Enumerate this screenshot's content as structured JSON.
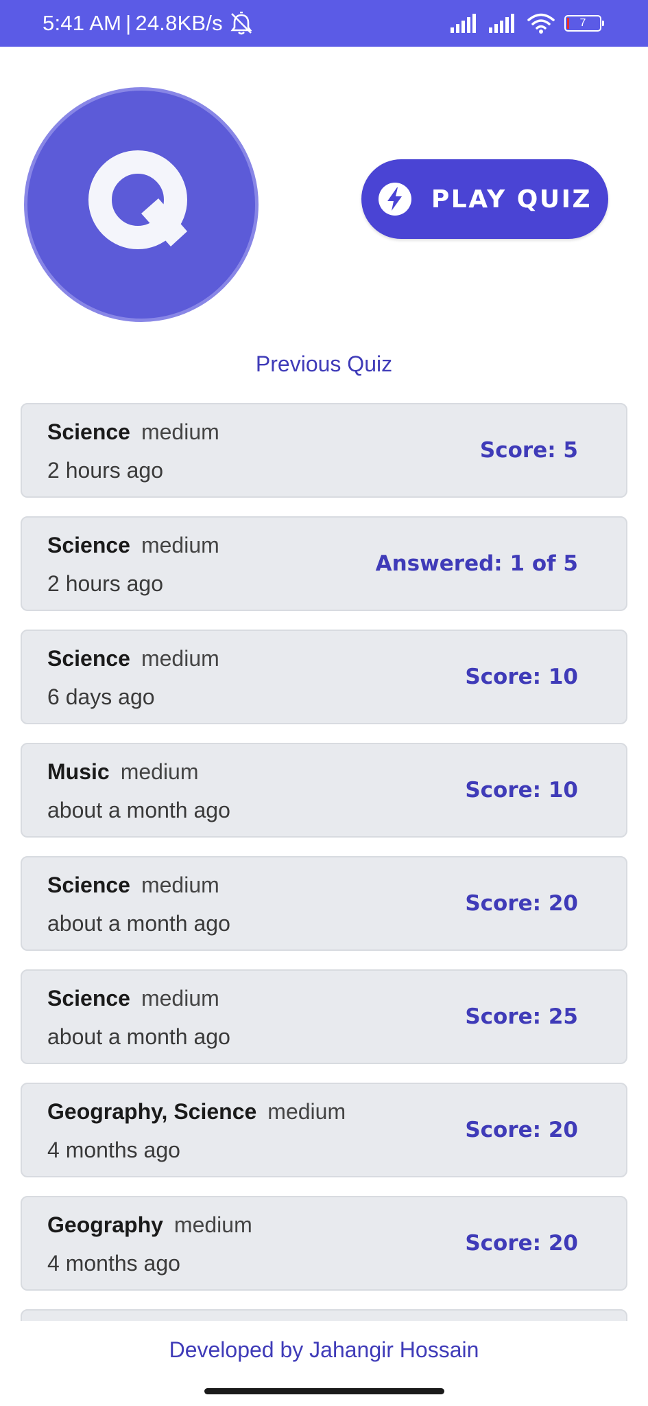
{
  "status_bar": {
    "time": "5:41 AM",
    "separator": "|",
    "network_speed": "24.8KB/s",
    "battery_level": "7",
    "icons": [
      "alarm-off-icon",
      "signal-bars-icon",
      "signal-bars-icon",
      "wifi-icon",
      "battery-icon"
    ],
    "background_color": "#5b5be6"
  },
  "header": {
    "logo_letter": "Q",
    "logo_color": "#5c5bd8",
    "play_button_label": "PLAY QUIZ",
    "play_button_icon": "lightning-bolt-icon",
    "play_button_color": "#4a44d4"
  },
  "section": {
    "title": "Previous Quiz"
  },
  "quizzes": [
    {
      "category": "Science",
      "difficulty": "medium",
      "time": "2 hours ago",
      "result": "Score: 5"
    },
    {
      "category": "Science",
      "difficulty": "medium",
      "time": "2 hours ago",
      "result": "Answered: 1 of 5"
    },
    {
      "category": "Science",
      "difficulty": "medium",
      "time": "6 days ago",
      "result": "Score: 10"
    },
    {
      "category": "Music",
      "difficulty": "medium",
      "time": "about a month ago",
      "result": "Score: 10"
    },
    {
      "category": "Science",
      "difficulty": "medium",
      "time": "about a month ago",
      "result": "Score: 20"
    },
    {
      "category": "Science",
      "difficulty": "medium",
      "time": "about a month ago",
      "result": "Score: 25"
    },
    {
      "category": "Geography, Science",
      "difficulty": "medium",
      "time": "4 months ago",
      "result": "Score: 20"
    },
    {
      "category": "Geography",
      "difficulty": "medium",
      "time": "4 months ago",
      "result": "Score: 20"
    },
    {
      "category": "",
      "difficulty": "",
      "time": "",
      "result": ""
    }
  ],
  "footer": {
    "credit": "Developed by Jahangir Hossain"
  },
  "colors": {
    "accent": "#3f3bb8",
    "card_background": "#e8eaee"
  }
}
